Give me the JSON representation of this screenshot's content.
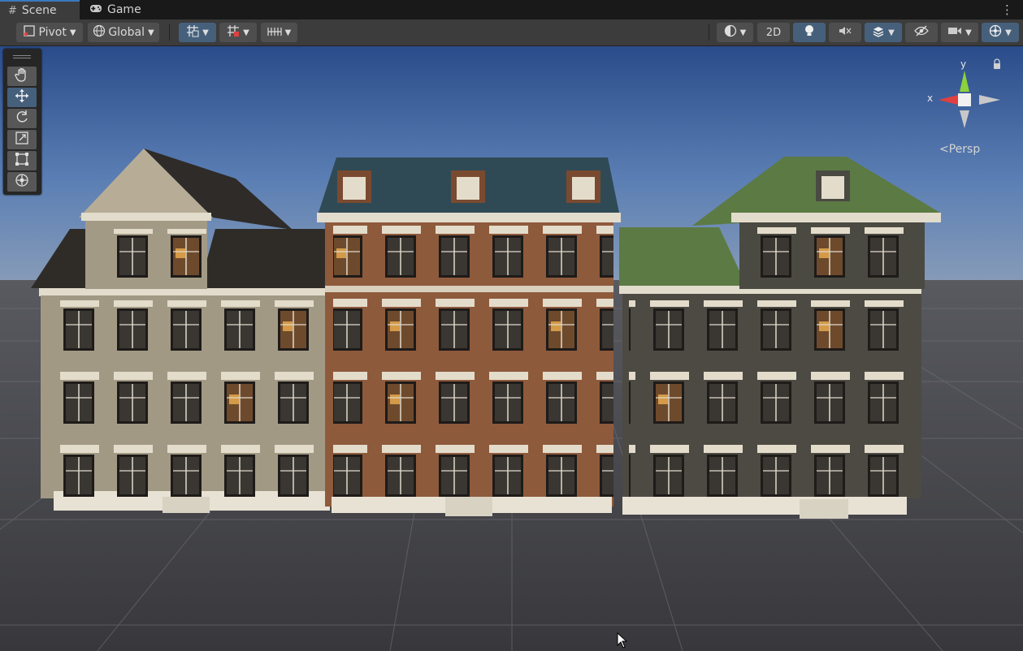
{
  "tabs": [
    {
      "label": "Scene",
      "icon": "hash-icon"
    },
    {
      "label": "Game",
      "icon": "gamepad-icon"
    }
  ],
  "toolbar": {
    "pivot_label": "Pivot",
    "global_label": "Global",
    "two_d_label": "2D"
  },
  "tools": [
    "hand-tool",
    "move-tool",
    "rotate-tool",
    "scale-tool",
    "rect-tool",
    "transform-tool"
  ],
  "active_tool": "move-tool",
  "gizmo": {
    "y_label": "y",
    "x_label": "x",
    "projection_label": "Persp"
  },
  "colors": {
    "accent": "#3a79bb",
    "active_button": "#46607c",
    "sky_top": "#2a4c8a",
    "ground": "#3e3e43",
    "gizmo_y": "#8fd13b",
    "gizmo_x": "#e04040"
  }
}
